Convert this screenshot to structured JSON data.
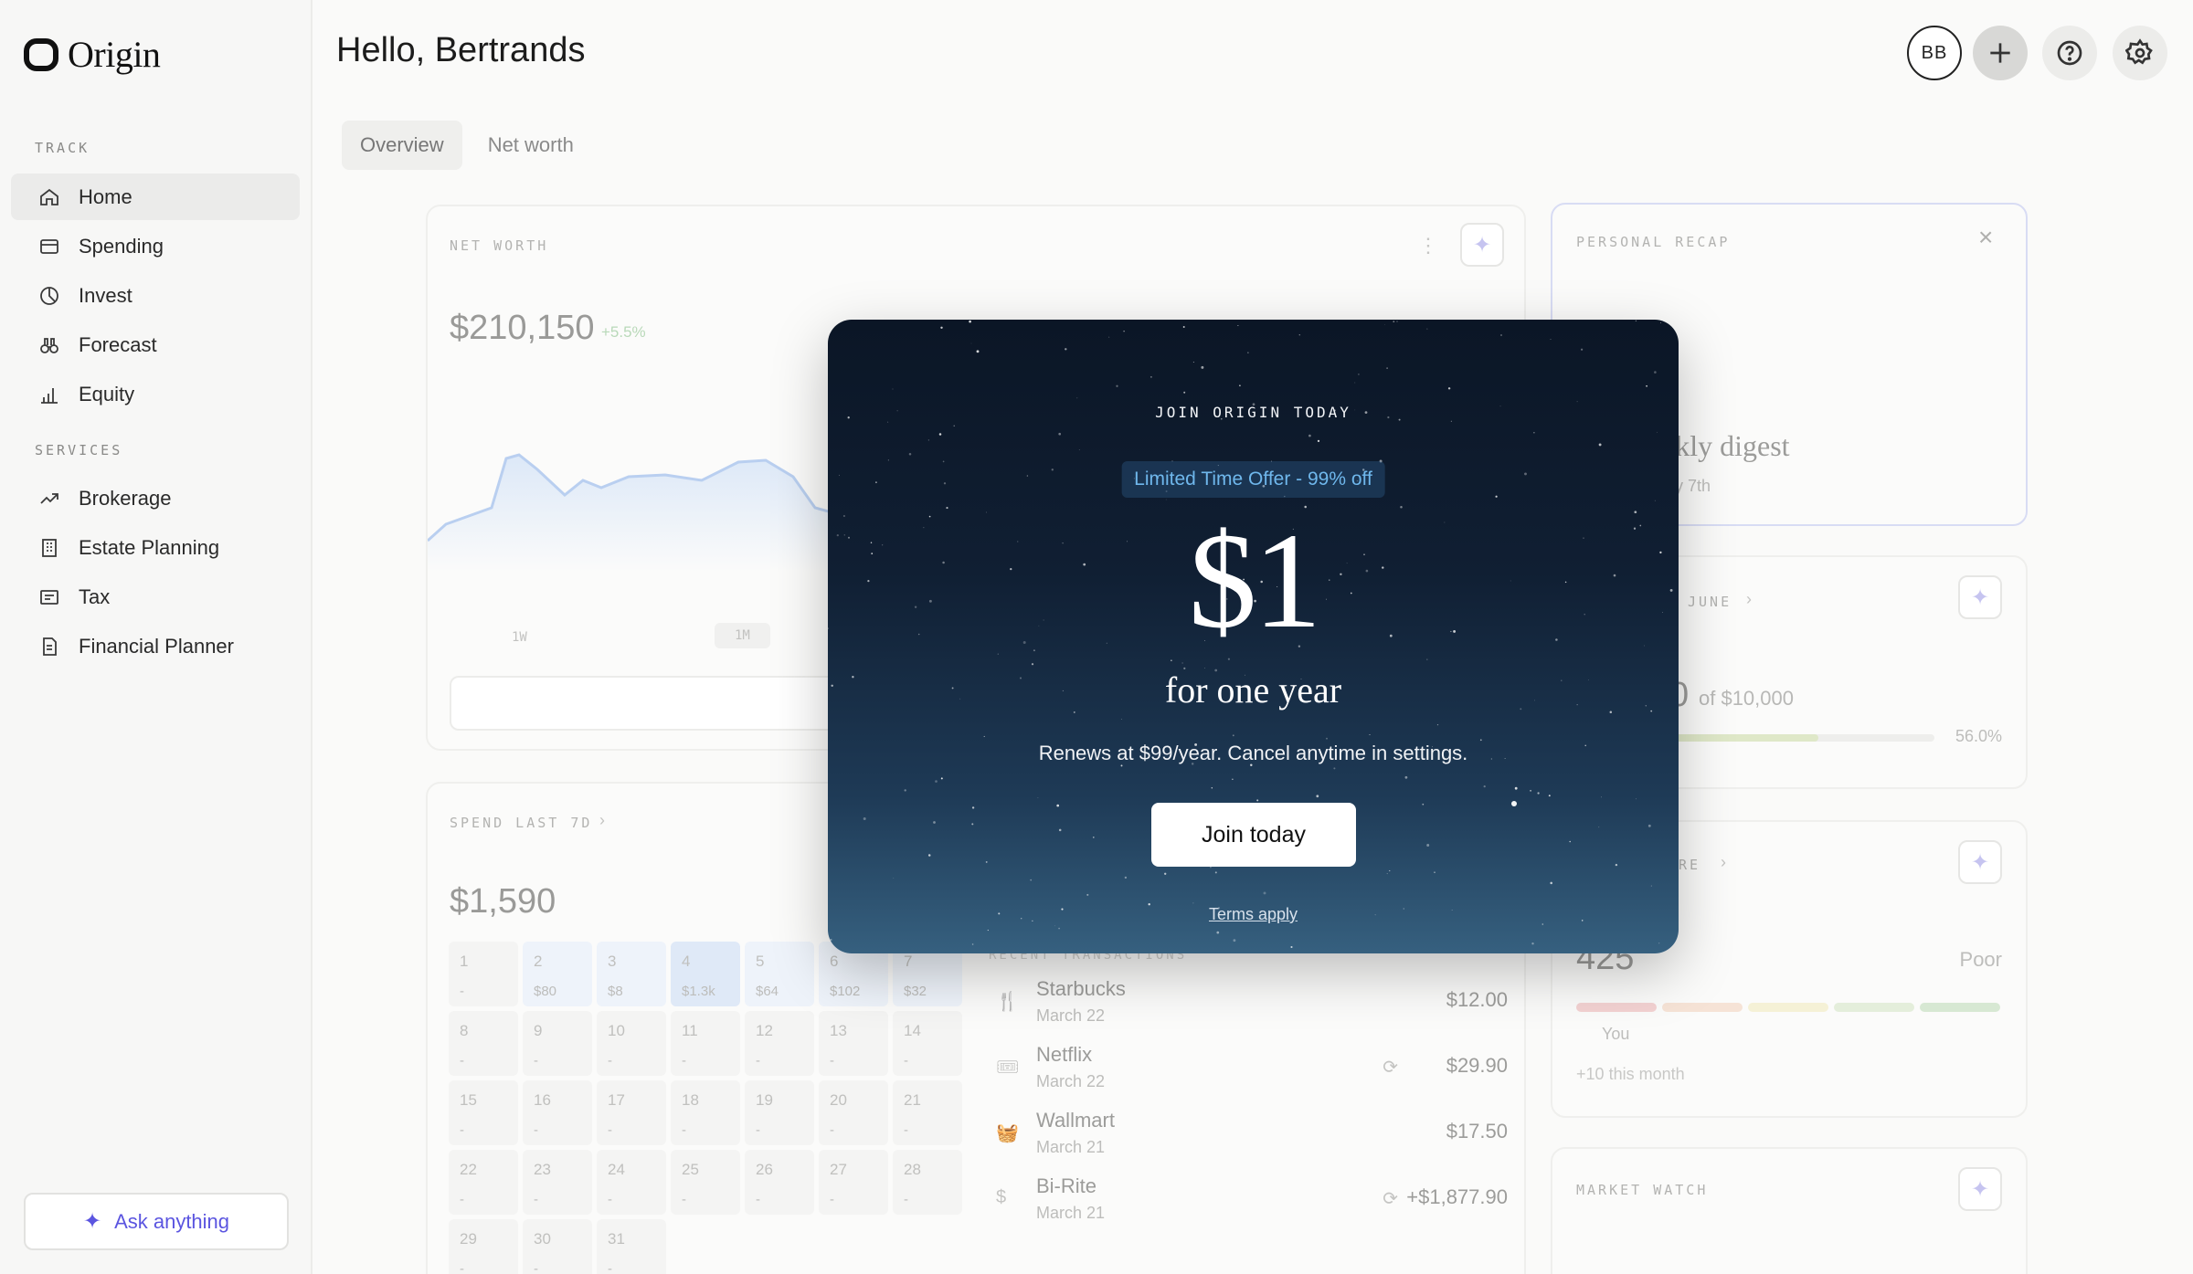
{
  "app": {
    "name": "Origin"
  },
  "sidebar": {
    "sections": [
      {
        "label": "TRACK",
        "items": [
          "Home",
          "Spending",
          "Invest",
          "Forecast",
          "Equity"
        ]
      },
      {
        "label": "SERVICES",
        "items": [
          "Brokerage",
          "Estate Planning",
          "Tax",
          "Financial Planner"
        ]
      }
    ],
    "ask_label": "Ask anything"
  },
  "header": {
    "greeting": "Hello, Bertrands",
    "avatar_initials": "BB"
  },
  "tabs": [
    "Overview",
    "Net worth"
  ],
  "net_worth": {
    "title": "NET WORTH",
    "value": "$210,150",
    "change": "+5.5%",
    "ranges": [
      "1W",
      "1M"
    ]
  },
  "personal_recap": {
    "title": "PERSONAL RECAP",
    "heading_fragment": "ekly digest",
    "date_fragment": "ly 7th"
  },
  "budget": {
    "title_fragment": "JUNE",
    "amount_fragment": "0",
    "of_label": "of $10,000",
    "percent": "56.0%",
    "fraction": 0.56
  },
  "credit": {
    "title_fragment": "ORE",
    "score": "425",
    "rating": "Poor",
    "you_label": "You",
    "delta": "+10",
    "delta_suffix": "this month"
  },
  "market_watch": {
    "title": "MARKET WATCH"
  },
  "spending": {
    "title": "SPEND LAST 7D",
    "value": "$1,590",
    "days": [
      {
        "d": "1",
        "a": "-"
      },
      {
        "d": "2",
        "a": "$80"
      },
      {
        "d": "3",
        "a": "$8"
      },
      {
        "d": "4",
        "a": "$1.3k"
      },
      {
        "d": "5",
        "a": "$64"
      },
      {
        "d": "6",
        "a": "$102"
      },
      {
        "d": "7",
        "a": "$32"
      },
      {
        "d": "8",
        "a": "-"
      },
      {
        "d": "9",
        "a": "-"
      },
      {
        "d": "10",
        "a": "-"
      },
      {
        "d": "11",
        "a": "-"
      },
      {
        "d": "12",
        "a": "-"
      },
      {
        "d": "13",
        "a": "-"
      },
      {
        "d": "14",
        "a": "-"
      },
      {
        "d": "15",
        "a": "-"
      },
      {
        "d": "16",
        "a": "-"
      },
      {
        "d": "17",
        "a": "-"
      },
      {
        "d": "18",
        "a": "-"
      },
      {
        "d": "19",
        "a": "-"
      },
      {
        "d": "20",
        "a": "-"
      },
      {
        "d": "21",
        "a": "-"
      },
      {
        "d": "22",
        "a": "-"
      },
      {
        "d": "23",
        "a": "-"
      },
      {
        "d": "24",
        "a": "-"
      },
      {
        "d": "25",
        "a": "-"
      },
      {
        "d": "26",
        "a": "-"
      },
      {
        "d": "27",
        "a": "-"
      },
      {
        "d": "28",
        "a": "-"
      },
      {
        "d": "29",
        "a": "-"
      },
      {
        "d": "30",
        "a": "-"
      },
      {
        "d": "31",
        "a": "-"
      }
    ]
  },
  "transactions": [
    {
      "name": "Starbucks",
      "date": "March 22",
      "amount": "$12.00",
      "recurring": false
    },
    {
      "name": "Netflix",
      "date": "March 22",
      "amount": "$29.90",
      "recurring": true
    },
    {
      "name": "Wallmart",
      "date": "March 21",
      "amount": "$17.50",
      "recurring": false
    },
    {
      "name": "Bi-Rite",
      "date": "March 21",
      "amount": "+$1,877.90",
      "recurring": true
    }
  ],
  "modal": {
    "eyebrow": "JOIN ORIGIN TODAY",
    "badge": "Limited Time Offer - 99% off",
    "price": "$1",
    "subtitle": "for one year",
    "description": "Renews at $99/year. Cancel anytime in settings.",
    "cta": "Join today",
    "terms": "Terms apply"
  },
  "colors": {
    "accent": "#5b55e0",
    "badge_text": "#6fb7ec",
    "modal_bg": "#0b1626"
  }
}
